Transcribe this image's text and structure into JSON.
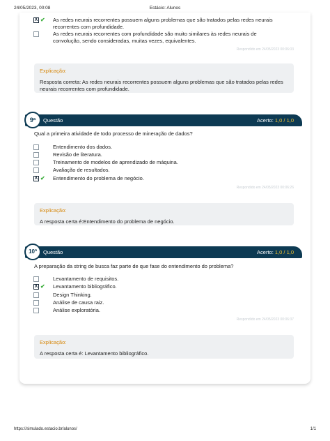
{
  "print_header": {
    "date": "24/05/2023, 00:08",
    "title": "Estácio: Alunos"
  },
  "print_footer": {
    "url": "https://simulado.estacio.br/alunos/",
    "pages": "1/1"
  },
  "q8_tail": {
    "options": [
      {
        "text": "As redes neurais recorrentes possuem alguns problemas que são tratados pelas redes neurais recorrentes com profundidade.",
        "selected": true,
        "correct": true
      },
      {
        "text": "As redes neurais recorrentes com profundidade são muito similares às redes neurais de convolução, sendo consideradas, muitas vezes, equivalentes.",
        "selected": false,
        "correct": false
      }
    ],
    "answered_at": "Respondido em 24/05/2023 00:06:03",
    "explanation_label": "Explicação:",
    "explanation": "Resposta correta: As redes neurais recorrentes possuem alguns problemas que são tratados pelas redes neurais recorrentes com profundidade."
  },
  "q9": {
    "number": "9ª",
    "label": "Questão",
    "score_label": "Acerto:",
    "score_value": "1,0 / 1,0",
    "question": "Qual a primeira atividade de todo processo de mineração de dados?",
    "options": [
      {
        "text": "Entendimento dos dados.",
        "selected": false
      },
      {
        "text": "Revisão de literatura.",
        "selected": false
      },
      {
        "text": "Treinamento de modelos de aprendizado de máquina.",
        "selected": false
      },
      {
        "text": "Avaliação de resultados.",
        "selected": false
      },
      {
        "text": "Entendimento do problema de negócio.",
        "selected": true,
        "correct": true
      }
    ],
    "answered_at": "Respondido em 24/05/2023 00:06:26",
    "explanation_label": "Explicação:",
    "explanation": "A resposta certa é:Entendimento do problema de negócio."
  },
  "q10": {
    "number": "10ª",
    "label": "Questão",
    "score_label": "Acerto:",
    "score_value": "1,0 / 1,0",
    "question": "A preparação da string de busca faz parte de que fase do entendimento do problema?",
    "options": [
      {
        "text": "Levantamento de requisitos.",
        "selected": false
      },
      {
        "text": "Levantamento bibliográfico.",
        "selected": true,
        "correct": true
      },
      {
        "text": "Design Thinking.",
        "selected": false
      },
      {
        "text": "Análise de causa raiz.",
        "selected": false
      },
      {
        "text": "Análise exploratória.",
        "selected": false
      }
    ],
    "answered_at": "Respondido em 24/05/2023 00:06:37",
    "explanation_label": "Explicação:",
    "explanation": "A resposta certa é: Levantamento bibliográfico."
  },
  "colors": {
    "header_bar": "#0d3a53",
    "score_value": "#f2c230",
    "explain_label": "#d7890e",
    "correct_tick": "#3cae3c"
  },
  "icons": {
    "checked_box": "X",
    "correct_tick": "✔"
  }
}
